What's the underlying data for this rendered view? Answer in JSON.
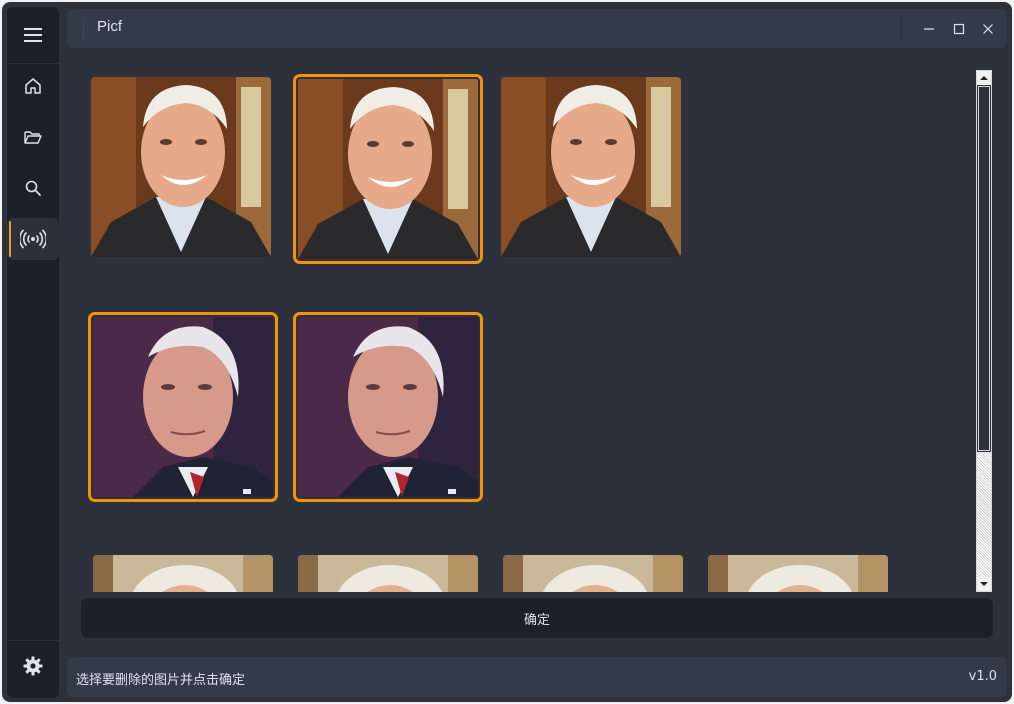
{
  "app": {
    "title": "Picf"
  },
  "sidebar": {
    "items": [
      {
        "name": "menu",
        "icon": "hamburger-icon"
      },
      {
        "name": "home",
        "icon": "home-icon"
      },
      {
        "name": "open-folder",
        "icon": "folder-open-icon"
      },
      {
        "name": "search",
        "icon": "search-icon"
      },
      {
        "name": "broadcast",
        "icon": "broadcast-icon",
        "active": true
      },
      {
        "name": "settings",
        "icon": "gear-icon"
      }
    ]
  },
  "window_controls": {
    "minimize": "minimize-icon",
    "maximize": "maximize-icon",
    "close": "close-icon"
  },
  "gallery": {
    "images": [
      {
        "row": 1,
        "col": 1,
        "subject": "smiling man in suit",
        "selected": false
      },
      {
        "row": 1,
        "col": 2,
        "subject": "smiling man in suit",
        "selected": true
      },
      {
        "row": 1,
        "col": 3,
        "subject": "smiling man in suit",
        "selected": false
      },
      {
        "row": 2,
        "col": 1,
        "subject": "man with red tie",
        "selected": true
      },
      {
        "row": 2,
        "col": 2,
        "subject": "man with red tie",
        "selected": true
      },
      {
        "row": 3,
        "col": 1,
        "subject": "partial image",
        "selected": false
      },
      {
        "row": 3,
        "col": 2,
        "subject": "partial image",
        "selected": false
      },
      {
        "row": 3,
        "col": 3,
        "subject": "partial image",
        "selected": false
      },
      {
        "row": 3,
        "col": 4,
        "subject": "partial image",
        "selected": false
      }
    ]
  },
  "actions": {
    "confirm_label": "确定"
  },
  "status": {
    "message": "选择要删除的图片并点击确定",
    "version": "v1.0"
  },
  "colors": {
    "accent": "#f5920a",
    "active_indicator": "#e8a317",
    "background": "#2c313c",
    "panel": "#1d2026"
  }
}
